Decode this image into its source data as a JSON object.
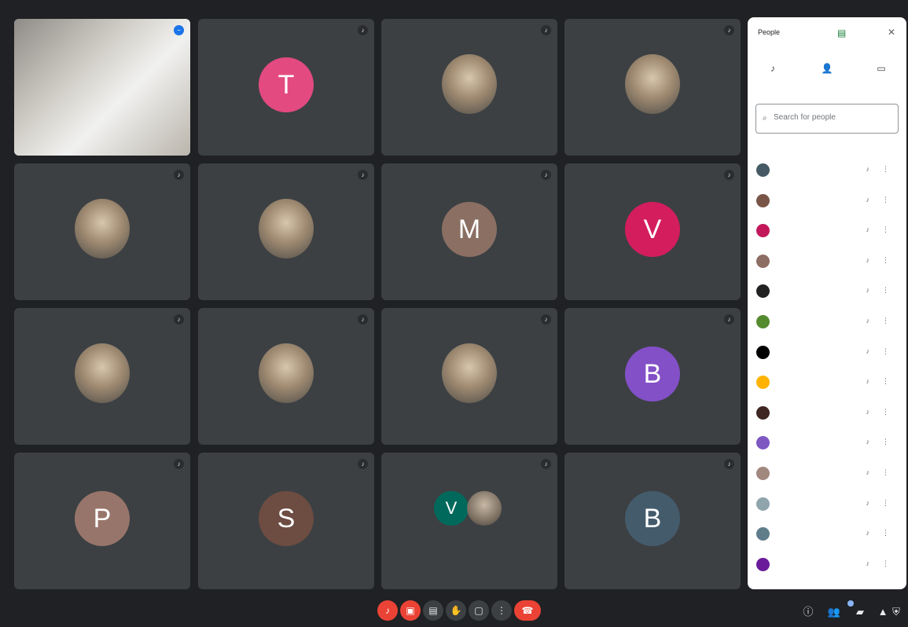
{
  "tiles": [
    {
      "name": "",
      "type": "camera",
      "mic_state": "blue"
    },
    {
      "name": "",
      "type": "letter",
      "letter": "T",
      "color": "#e34a7f",
      "mic_state": "muted"
    },
    {
      "name": "",
      "type": "photo",
      "mic_state": "muted"
    },
    {
      "name": "",
      "type": "photo",
      "mic_state": "muted"
    },
    {
      "name": "",
      "type": "photo",
      "mic_state": "muted"
    },
    {
      "name": "",
      "type": "photo",
      "mic_state": "muted"
    },
    {
      "name": "",
      "type": "letter",
      "letter": "M",
      "color": "#8b6f63",
      "mic_state": "muted"
    },
    {
      "name": "",
      "type": "letter",
      "letter": "V",
      "color": "#d41d5c",
      "mic_state": "muted"
    },
    {
      "name": "",
      "type": "photo",
      "mic_state": "muted"
    },
    {
      "name": "",
      "type": "photo",
      "mic_state": "muted"
    },
    {
      "name": "",
      "type": "photo",
      "mic_state": "muted"
    },
    {
      "name": "",
      "type": "letter",
      "letter": "B",
      "color": "#8350c7",
      "mic_state": "muted"
    },
    {
      "name": "",
      "type": "letter",
      "letter": "P",
      "color": "#98756a",
      "mic_state": "muted"
    },
    {
      "name": "",
      "type": "letter",
      "letter": "S",
      "color": "#6d4c41",
      "mic_state": "muted"
    },
    {
      "name": "",
      "type": "pair",
      "letter": "V",
      "color": "#00695c",
      "mic_state": "muted"
    },
    {
      "name": "",
      "type": "letter",
      "letter": "B",
      "color": "#445b6c",
      "mic_state": "muted"
    }
  ],
  "panel": {
    "title": "People",
    "actions": [
      "",
      "",
      ""
    ],
    "search_placeholder": "Search for people",
    "section_label": "",
    "people": [
      {
        "initial": "",
        "color": "#455a64"
      },
      {
        "initial": "",
        "color": "#795548"
      },
      {
        "initial": "",
        "color": "#c2185b"
      },
      {
        "initial": "",
        "color": "#8d6e63"
      },
      {
        "initial": "",
        "color": "#212121"
      },
      {
        "initial": "",
        "color": "#558b2f"
      },
      {
        "initial": "",
        "color": "#000000"
      },
      {
        "initial": "",
        "color": "#ffb300"
      },
      {
        "initial": "",
        "color": "#3e2723"
      },
      {
        "initial": "",
        "color": "#7e57c2"
      },
      {
        "initial": "",
        "color": "#a1887f"
      },
      {
        "initial": "",
        "color": "#90a4ae"
      },
      {
        "initial": "",
        "color": "#607d8b"
      },
      {
        "initial": "",
        "color": "#6a1b9a"
      }
    ]
  },
  "bottombar": {
    "meeting_code": "",
    "controls": [
      "mic-off",
      "camera-off",
      "captions",
      "raise-hand",
      "present",
      "more",
      "leave"
    ]
  },
  "colors": {
    "background": "#202124",
    "tile": "#3c4043",
    "danger": "#ea4335",
    "accent": "#8ab4f8"
  }
}
